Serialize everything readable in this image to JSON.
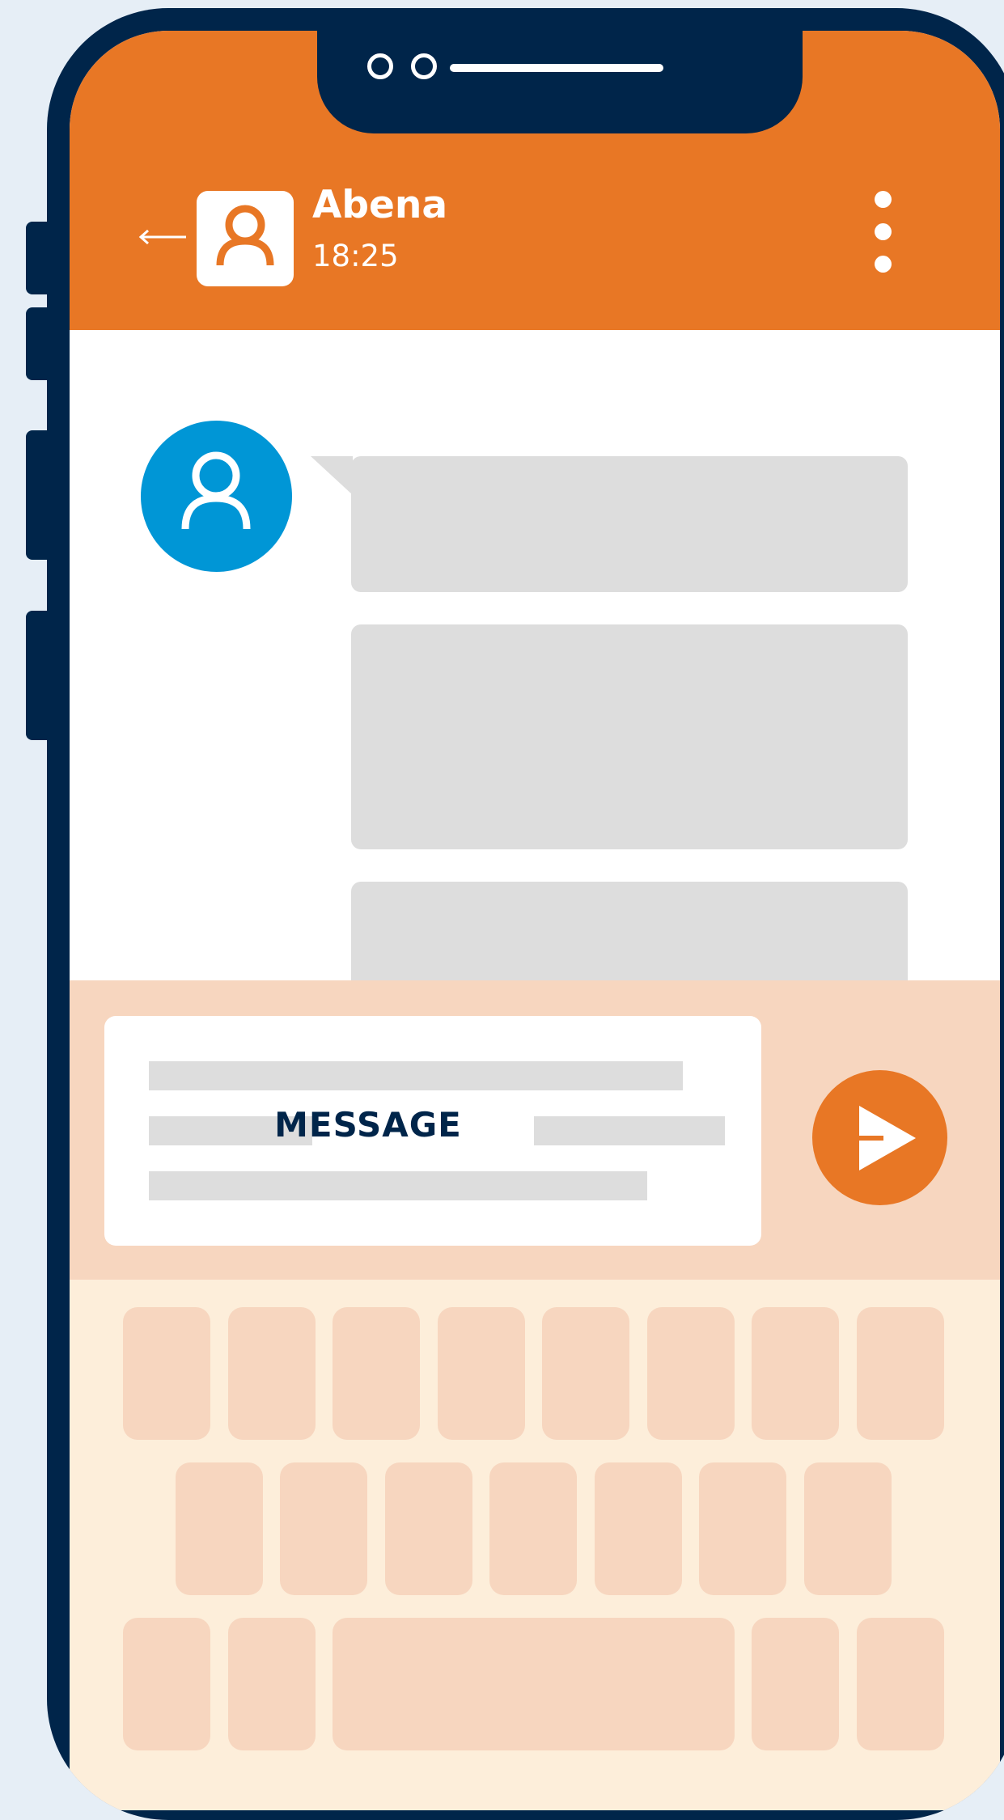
{
  "colors": {
    "background": "#e6eef6",
    "frame": "#00254a",
    "header": "#e87725",
    "screen": "#ffffff",
    "avatar_contact": "#0096d6",
    "bubble_placeholder": "#dddddd",
    "input_area": "#f7d6bf",
    "keyboard_background": "#fdeeda",
    "key": "#f7d6bf",
    "send_button": "#e87725"
  },
  "header": {
    "back_icon": "left-arrow-icon",
    "avatar_icon": "user-icon",
    "contact_name": "Abena",
    "time": "18:25",
    "menu_icon": "vertical-dots-icon"
  },
  "chat": {
    "avatar_icon": "user-icon",
    "message_bubbles": 3
  },
  "composer": {
    "label": "MESSAGE",
    "send_icon": "send-icon"
  },
  "keyboard": {
    "rows": [
      8,
      7,
      5
    ]
  }
}
